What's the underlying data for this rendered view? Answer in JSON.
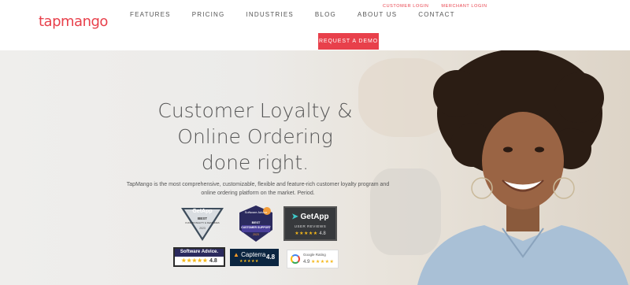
{
  "brand": {
    "logo_text": "tapmango"
  },
  "nav": {
    "items": [
      {
        "label": "FEATURES"
      },
      {
        "label": "PRICING"
      },
      {
        "label": "INDUSTRIES"
      },
      {
        "label": "BLOG"
      },
      {
        "label": "ABOUT US"
      },
      {
        "label": "CONTACT"
      }
    ]
  },
  "utility": {
    "customer_login": "CUSTOMER LOGIN",
    "merchant_login": "MERCHANT LOGIN"
  },
  "cta": {
    "label": "REQUEST A DEMO"
  },
  "hero": {
    "headline_lines": [
      "Customer Loyalty &",
      "Online Ordering",
      "done right."
    ],
    "description": "TapMango is the most comprehensive, customizable, flexible and feature-rich customer loyalty program and online ordering platform on the market. Period."
  },
  "badges": {
    "getapp_best": {
      "brand": "GetApp",
      "line1": "BEST",
      "line2": "FUNCTIONALITY & FEATURES",
      "year": "2023"
    },
    "software_advice_support": {
      "brand": "Software Advice",
      "line1": "BEST",
      "line2": "CUSTOMER SUPPORT",
      "year": "2023"
    },
    "getapp_reviews": {
      "brand": "GetApp",
      "line1": "USER REVIEWS",
      "stars": "★★★★★",
      "rating": "4.8"
    },
    "software_advice_rating": {
      "brand": "Software Advice.",
      "stars": "★★★★★",
      "rating": "4.8"
    },
    "capterra_rating": {
      "brand": "Capterra",
      "stars": "★★★★★",
      "rating": "4.8"
    },
    "google_rating": {
      "label": "Google Rating",
      "rating": "4.9",
      "stars": "★★★★★"
    }
  },
  "colors": {
    "accent": "#e8404b",
    "nav_text": "#555555"
  }
}
